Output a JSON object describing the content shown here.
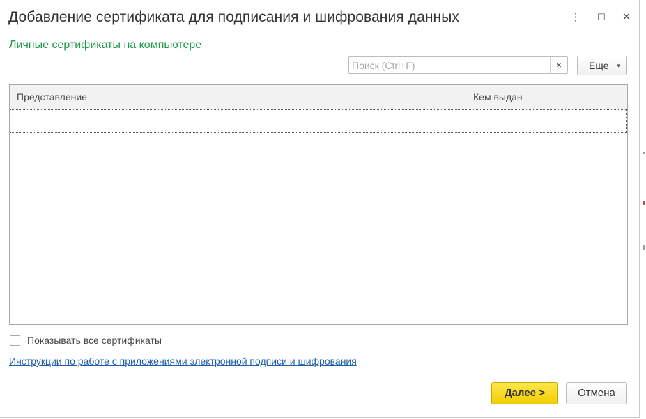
{
  "window": {
    "title": "Добавление сертификата для подписания и шифрования данных",
    "menu_icon": "⋮",
    "maximize_icon": "☐",
    "close_icon": "✕"
  },
  "subtitle": "Личные сертификаты на компьютере",
  "search": {
    "placeholder": "Поиск (Ctrl+F)",
    "value": "",
    "clear_icon": "×"
  },
  "more_button": {
    "label": "Еще",
    "caret": "▾"
  },
  "table": {
    "columns": [
      "Представление",
      "Кем выдан"
    ],
    "rows": []
  },
  "show_all": {
    "label": "Показывать все сертификаты",
    "checked": false
  },
  "instructions_link": "Инструкции по работе с приложениями электронной подписи и шифрования",
  "buttons": {
    "next": "Далее >",
    "cancel": "Отмена"
  },
  "colors": {
    "subtitle": "#1a9a4a",
    "link": "#1f5fa8",
    "primary_button": "#f5d20a"
  }
}
